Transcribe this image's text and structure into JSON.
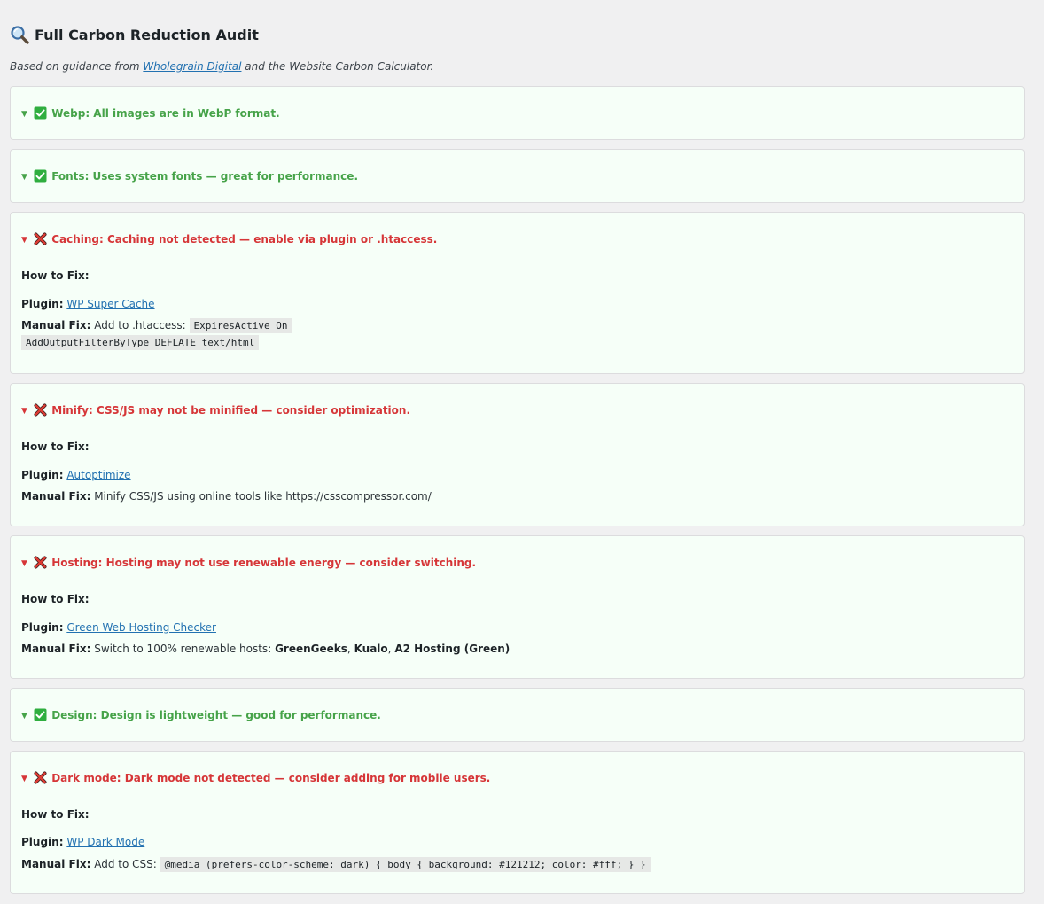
{
  "page": {
    "title": "Full Carbon Reduction Audit",
    "title_icon": "magnifier-icon",
    "subtitle_prefix": "Based on guidance from",
    "subtitle_link": "Wholegrain Digital",
    "subtitle_suffix": "and the Website Carbon Calculator."
  },
  "colors": {
    "pass": "#46a349",
    "fail": "#d63638",
    "card_bg": "#f6fff8",
    "link": "#2271b1"
  },
  "labels": {
    "how_to_fix": "How to Fix:",
    "plugin": "Plugin:",
    "manual_fix": "Manual Fix:"
  },
  "checks": [
    {
      "id": "webp",
      "status": "pass",
      "summary": "Webp: All images are in WebP format."
    },
    {
      "id": "fonts",
      "status": "pass",
      "summary": "Fonts: Uses system fonts — great for performance."
    },
    {
      "id": "caching",
      "status": "fail",
      "summary": "Caching: Caching not detected — enable via plugin or .htaccess.",
      "plugin": "WP Super Cache",
      "manual_text": "Add to .htaccess:",
      "code_1": "ExpiresActive On",
      "code_2": "AddOutputFilterByType DEFLATE text/html"
    },
    {
      "id": "minify",
      "status": "fail",
      "summary": "Minify: CSS/JS may not be minified — consider optimization.",
      "plugin": "Autoptimize",
      "manual_text": "Minify CSS/JS using online tools like https://csscompressor.com/"
    },
    {
      "id": "hosting",
      "status": "fail",
      "summary": "Hosting: Hosting may not use renewable energy — consider switching.",
      "plugin": "Green Web Hosting Checker",
      "manual_text": "Switch to 100% renewable hosts:",
      "hosts": [
        "GreenGeeks",
        "Kualo",
        "A2 Hosting (Green)"
      ],
      "separator": ","
    },
    {
      "id": "design",
      "status": "pass",
      "summary": "Design: Design is lightweight — good for performance."
    },
    {
      "id": "darkmode",
      "status": "fail",
      "summary": "Dark mode: Dark mode not detected — consider adding for mobile users.",
      "plugin": "WP Dark Mode",
      "manual_text": "Add to CSS:",
      "code_1": "@media (prefers-color-scheme: dark) { body { background: #121212; color: #fff; } }"
    }
  ]
}
